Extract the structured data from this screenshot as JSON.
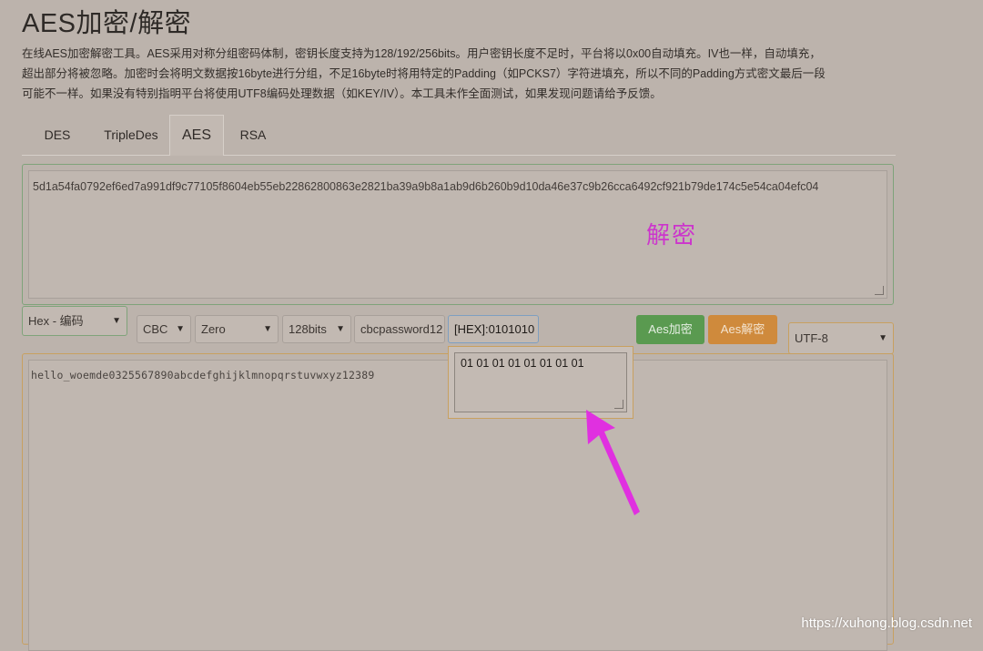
{
  "page": {
    "title": "AES加密/解密",
    "description_lines": [
      "在线AES加密解密工具。AES采用对称分组密码体制，密钥长度支持为128/192/256bits。用户密钥长度不足时，平台将以0x00自动填充。IV也一样，自动填充，",
      "超出部分将被忽略。加密时会将明文数据按16byte进行分组，不足16byte时将用特定的Padding（如PCKS7）字符进填充，所以不同的Padding方式密文最后一段",
      "可能不一样。如果没有特别指明平台将使用UTF8编码处理数据（如KEY/IV）。本工具未作全面测试，如果发现问题请给予反馈。"
    ]
  },
  "tabs": [
    {
      "label": "DES"
    },
    {
      "label": "TripleDes"
    },
    {
      "label": "AES",
      "active": true
    },
    {
      "label": "RSA"
    }
  ],
  "cipher": {
    "value": "5d1a54fa0792ef6ed7a991df9c77105f8604eb55eb22862800863e2821ba39a9b8a1ab9d6b260b9d10da46e37c9b26cca6492cf921b79de174c5e54ca04efc04",
    "annotation": "解密"
  },
  "controls": {
    "encoding": "Hex - 编码",
    "mode": "CBC",
    "padding": "Zero",
    "key_size": "128bits",
    "password": "cbcpassword12",
    "iv": "[HEX]:0101010",
    "encrypt_label": "Aes加密",
    "decrypt_label": "Aes解密",
    "charset": "UTF-8"
  },
  "plaintext": {
    "value": "hello_woemde0325567890abcdefghijklmnopqrstuvwxyz12389"
  },
  "iv_popup": {
    "value": "01 01 01 01 01 01 01 01"
  },
  "watermark": "https://xuhong.blog.csdn.net",
  "colors": {
    "encrypt_button": "#5a9a50",
    "decrypt_button": "#cf8a3c",
    "annotation": "#cc35cc",
    "arrow": "#e030e0"
  }
}
